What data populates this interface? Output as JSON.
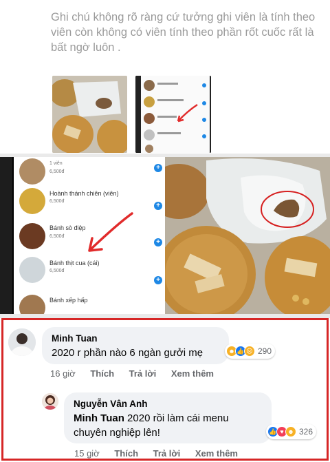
{
  "post": {
    "text": "Ghi chú không rõ ràng cứ tưởng ghi viên là tính theo viên còn không có viên tính theo phần rốt cuốc rất là bất ngờ luôn ."
  },
  "menu": {
    "items": [
      {
        "name": "",
        "unit": "1 viên",
        "price": "6,500đ"
      },
      {
        "name": "Hoành thánh chiên (viên)",
        "price": "6,500đ"
      },
      {
        "name": "Bánh sò điệp",
        "price": "6,500đ"
      },
      {
        "name": "Bánh thịt cua (cái)",
        "price": "6,500đ"
      },
      {
        "name": "Bánh xếp hấp",
        "price": ""
      }
    ]
  },
  "comments": [
    {
      "author": "Minh Tuan",
      "text": "2020 r phần nào 6 ngàn gưởi mẹ",
      "time": "16 giờ",
      "like": "Thích",
      "reply": "Trả lời",
      "more": "Xem thêm",
      "reaction_count": "290",
      "reactions": [
        "haha",
        "like",
        "sad"
      ]
    },
    {
      "author": "Nguyễn Vân Anh",
      "mention": "Minh Tuan",
      "text_line1": " 2020 rồi làm cái menu",
      "text_line2": "chuyên nghiệp lên!",
      "time": "15 giờ",
      "like": "Thích",
      "reply": "Trả lời",
      "more": "Xem thêm",
      "reaction_count": "326",
      "reactions": [
        "like",
        "love",
        "haha"
      ]
    }
  ],
  "colors": {
    "highlight_border": "#d62626",
    "reaction_like": "#1877f2",
    "reaction_love": "#f33e58",
    "reaction_haha": "#f7b125"
  }
}
